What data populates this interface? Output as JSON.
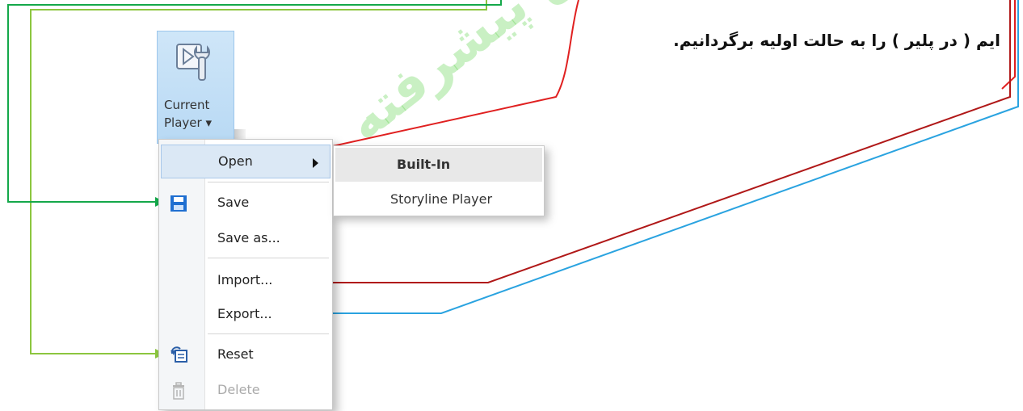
{
  "caption": "ایم ( در پلیر ) را به حالت اولیه برگردانیم.",
  "watermark": "آموزش پیشرفته",
  "ribbon": {
    "label_line1": "Current",
    "label_line2": "Player ▾"
  },
  "menu": {
    "items": [
      {
        "label": "Open",
        "icon": "none"
      },
      {
        "label": "Save",
        "icon": "floppy-disk-icon"
      },
      {
        "label": "Save as...",
        "icon": "none"
      },
      {
        "label": "Import...",
        "icon": "none"
      },
      {
        "label": "Export...",
        "icon": "none"
      },
      {
        "label": "Reset",
        "icon": "reset-icon"
      },
      {
        "label": "Delete",
        "icon": "trash-icon",
        "disabled": true
      }
    ]
  },
  "submenu": {
    "header": "Built-In",
    "items": [
      {
        "label": "Storyline Player"
      }
    ]
  },
  "colors": {
    "green_arrow": "#14a84a",
    "light_green_arrow": "#8cc63f",
    "red_arrow": "#e02020",
    "dark_red_arrow": "#b01818",
    "blue_arrow": "#2aa3e0"
  }
}
